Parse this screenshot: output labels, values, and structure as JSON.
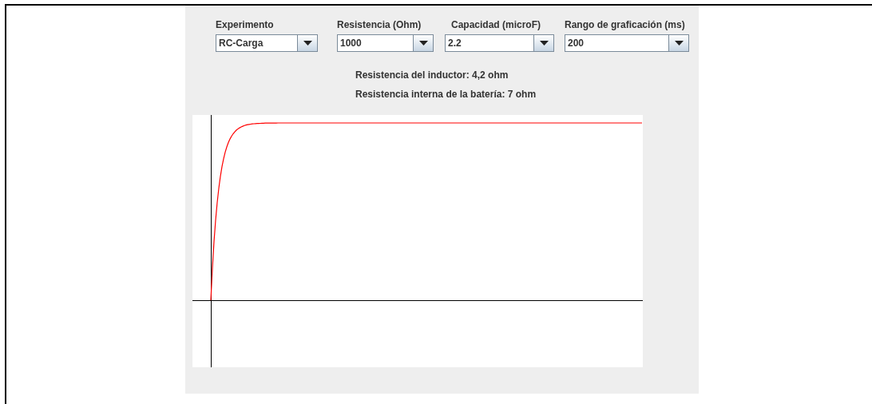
{
  "controls": [
    {
      "label": "Experimento",
      "value": "RC-Carga"
    },
    {
      "label": "Resistencia (Ohm)",
      "value": "1000"
    },
    {
      "label": "Capacidad (microF)",
      "value": "2.2"
    },
    {
      "label": "Rango de graficación (ms)",
      "value": "200"
    }
  ],
  "info": [
    "Resistencia del inductor: 4,2 ohm",
    "Resistencia interna de la batería: 7 ohm"
  ],
  "plot": {
    "kind": "charge-curve"
  }
}
